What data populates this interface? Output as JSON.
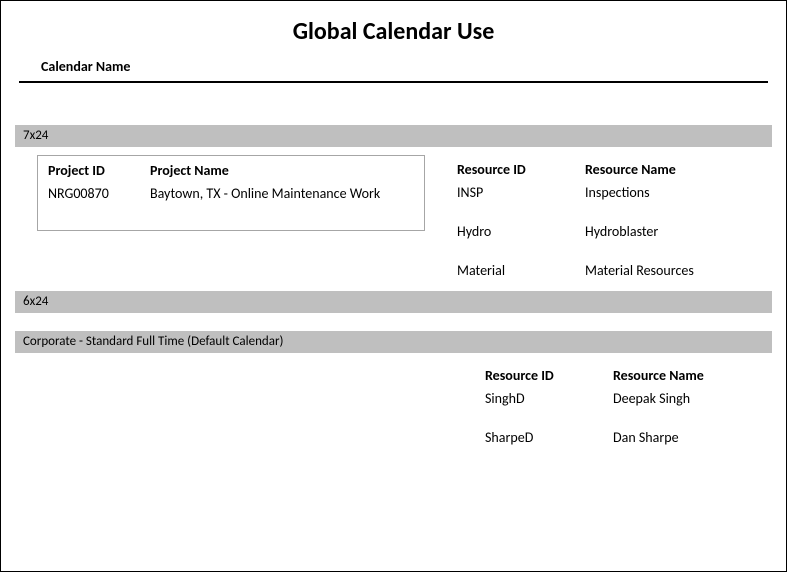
{
  "report": {
    "title": "Global Calendar Use",
    "section_label": "Calendar Name"
  },
  "calendars": [
    {
      "name": "7x24",
      "projects": {
        "headers": {
          "id": "Project ID",
          "name": "Project Name"
        },
        "rows": [
          {
            "id": "NRG00870",
            "name": "Baytown, TX - Online Maintenance Work"
          }
        ]
      },
      "resources": {
        "headers": {
          "id": "Resource ID",
          "name": "Resource Name"
        },
        "rows": [
          {
            "id": "INSP",
            "name": "Inspections"
          },
          {
            "id": "Hydro",
            "name": "Hydroblaster"
          },
          {
            "id": "Material",
            "name": "Material Resources"
          }
        ]
      }
    },
    {
      "name": "6x24"
    },
    {
      "name": "Corporate - Standard Full Time   (Default Calendar)",
      "resources": {
        "headers": {
          "id": "Resource ID",
          "name": "Resource Name"
        },
        "rows": [
          {
            "id": "SinghD",
            "name": "Deepak Singh"
          },
          {
            "id": "SharpeD",
            "name": "Dan Sharpe"
          }
        ]
      }
    }
  ]
}
